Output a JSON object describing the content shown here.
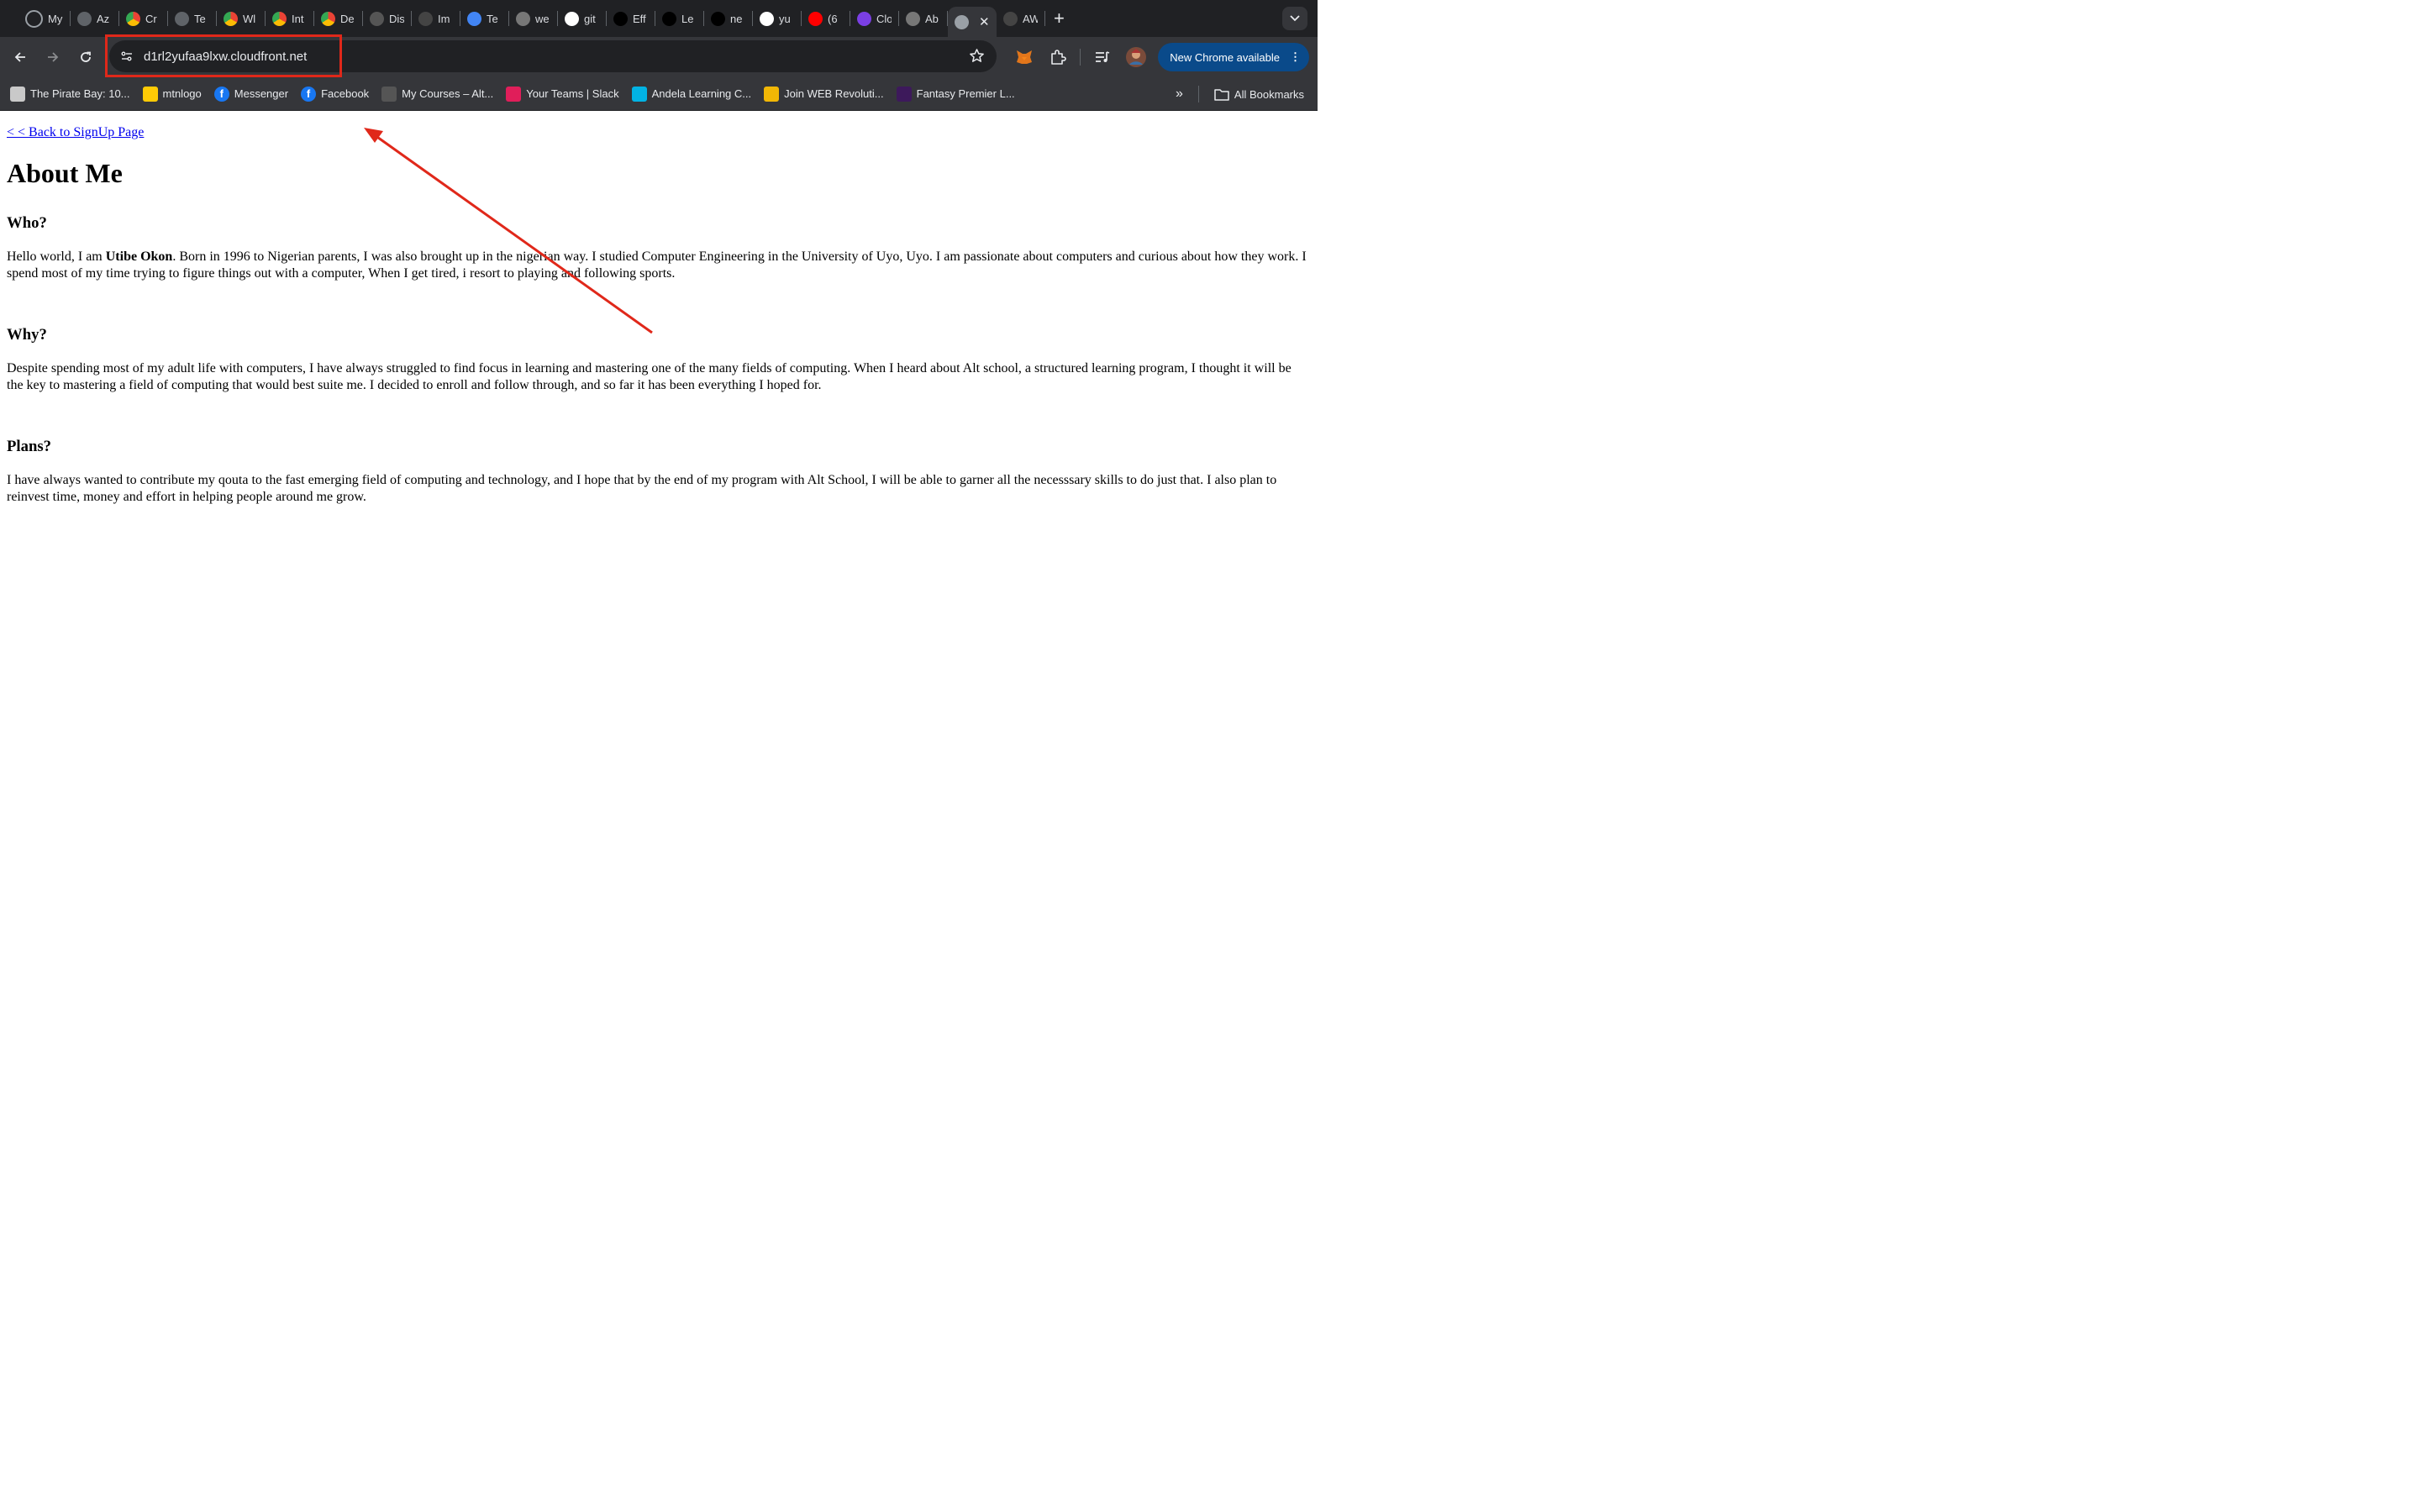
{
  "browser": {
    "tabs": [
      {
        "title": "My",
        "icon": "loading-icon"
      },
      {
        "title": "Az",
        "icon": "chatgpt-icon"
      },
      {
        "title": "Cr",
        "icon": "chrome-icon"
      },
      {
        "title": "Te",
        "icon": "chatgpt-icon"
      },
      {
        "title": "Wl",
        "icon": "chrome-icon"
      },
      {
        "title": "Int",
        "icon": "chrome-icon"
      },
      {
        "title": "De",
        "icon": "chrome-icon"
      },
      {
        "title": "Dis",
        "icon": "vue-icon"
      },
      {
        "title": "Im",
        "icon": "openai-icon"
      },
      {
        "title": "Te",
        "icon": "docs-icon"
      },
      {
        "title": "we",
        "icon": "globe-icon"
      },
      {
        "title": "git",
        "icon": "github-icon"
      },
      {
        "title": "Eff",
        "icon": "dev-icon"
      },
      {
        "title": "Le",
        "icon": "nextjs-icon"
      },
      {
        "title": "ne",
        "icon": "vercel-icon"
      },
      {
        "title": "yu",
        "icon": "github-icon"
      },
      {
        "title": "(6",
        "icon": "youtube-icon"
      },
      {
        "title": "Clo",
        "icon": "cloud-icon"
      },
      {
        "title": "Ab",
        "icon": "globe-icon"
      }
    ],
    "after_active_tab": {
      "title": "AW",
      "icon": "openai-icon"
    },
    "url": "d1rl2yufaa9lxw.cloudfront.net",
    "update_button_label": "New Chrome available",
    "bookmarks": [
      {
        "label": "The Pirate Bay: 10...",
        "icon": "pirate-ship-icon",
        "color": "#c9c9c9"
      },
      {
        "label": "mtnlogo",
        "icon": "mtn-icon",
        "color": "#ffcb05"
      },
      {
        "label": "Messenger",
        "icon": "facebook-icon",
        "color": "#1877f2"
      },
      {
        "label": "Facebook",
        "icon": "facebook-icon",
        "color": "#1877f2"
      },
      {
        "label": "My Courses – Alt...",
        "icon": "altschool-icon",
        "color": "#555"
      },
      {
        "label": "Your Teams | Slack",
        "icon": "slack-icon",
        "color": "#e01e5a"
      },
      {
        "label": "Andela Learning C...",
        "icon": "udacity-icon",
        "color": "#02b3e4"
      },
      {
        "label": "Join WEB Revoluti...",
        "icon": "web-icon",
        "color": "#f2b705"
      },
      {
        "label": "Fantasy Premier L...",
        "icon": "premier-league-icon",
        "color": "#3d195b"
      }
    ],
    "all_bookmarks_label": "All Bookmarks"
  },
  "page": {
    "back_link": "< < Back to SignUp Page",
    "title": "About Me",
    "sections": [
      {
        "heading": "Who?",
        "text_before": "Hello world, I am ",
        "bold": "Utibe Okon",
        "text_after": ". Born in 1996 to Nigerian parents, I was also brought up in the nigerian way. I studied Computer Engineering in the University of Uyo, Uyo. I am passionate about computers and curious about how they work. I spend most of my time trying to figure things out with a computer, When I get tired, i resort to playing and following sports."
      },
      {
        "heading": "Why?",
        "text": "Despite spending most of my adult life with computers, I have always struggled to find focus in learning and mastering one of the many fields of computing. When I heard about Alt school, a structured learning program, I thought it will be the key to mastering a field of computing that would best suite me. I decided to enroll and follow through, and so far it has been everything I hoped for."
      },
      {
        "heading": "Plans?",
        "text": "I have always wanted to contribute my qouta to the fast emerging field of computing and technology, and I hope that by the end of my program with Alt School, I will be able to garner all the necesssary skills to do just that. I also plan to reinvest time, money and effort in helping people around me grow."
      }
    ]
  },
  "annotation": {
    "color": "#e0281a"
  }
}
